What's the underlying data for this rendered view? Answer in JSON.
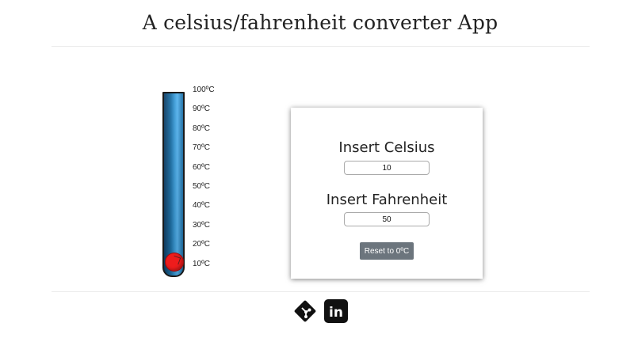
{
  "header": {
    "title": "A celsius/fahrenheit converter App"
  },
  "thermometer": {
    "scale_labels": [
      "100ºC",
      "90ºC",
      "80ºC",
      "70ºC",
      "60ºC",
      "50ºC",
      "40ºC",
      "30ºC",
      "20ºC",
      "10ºC"
    ],
    "current_celsius": 10,
    "liquid_color": "#ee1c1c",
    "tube_color": "#1c6fa5"
  },
  "converter": {
    "celsius_heading": "Insert Celsius",
    "celsius_value": "10",
    "fahrenheit_heading": "Insert Fahrenheit",
    "fahrenheit_value": "50",
    "reset_label": "Reset to 0ºC",
    "reset_color": "#6c757d"
  },
  "footer": {
    "icons": [
      "git-icon",
      "linkedin-icon"
    ],
    "linkedin_text": "in"
  }
}
